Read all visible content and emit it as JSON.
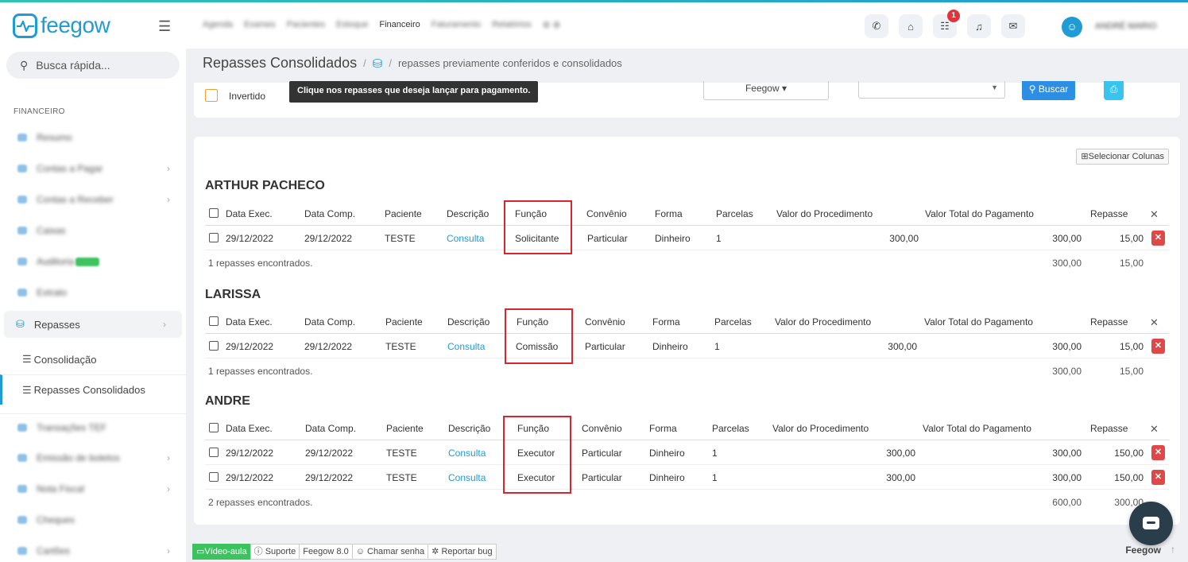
{
  "header": {
    "logo_text": "feegow",
    "nav_items": [
      "Agenda",
      "Exames",
      "Pacientes",
      "Estoque",
      "Financeiro",
      "Faturamento",
      "Relatórios"
    ],
    "active_nav": "Financeiro",
    "notification_count": "1",
    "username": "ANDRÉ MARIO"
  },
  "sidebar": {
    "search_placeholder": "Busca rápida...",
    "section_title": "FINANCEIRO",
    "items": [
      {
        "label": "Resumo"
      },
      {
        "label": "Contas a Pagar"
      },
      {
        "label": "Contas a Receber"
      },
      {
        "label": "Caixas"
      },
      {
        "label": "Auditoria"
      },
      {
        "label": "Extrato"
      },
      {
        "label": "Repasses"
      },
      {
        "label": "Consolidação"
      },
      {
        "label": "Repasses Consolidados"
      },
      {
        "label": "Transações TEF"
      },
      {
        "label": "Emissão de boletos"
      },
      {
        "label": "Nota Fiscal"
      },
      {
        "label": "Cheques"
      },
      {
        "label": "Cartões"
      }
    ]
  },
  "breadcrumb": {
    "title": "Repasses Consolidados",
    "subtitle": "repasses previamente conferidos e consolidados"
  },
  "filters": {
    "invertido_label": "Invertido",
    "tooltip": "Clique nos repasses que deseja lançar para pagamento.",
    "unit_select": "Feegow",
    "search_button": "Buscar"
  },
  "main": {
    "select_columns": "Selecionar Colunas",
    "columns": [
      "Data Exec.",
      "Data Comp.",
      "Paciente",
      "Descrição",
      "Função",
      "Convênio",
      "Forma",
      "Parcelas",
      "Valor do Procedimento",
      "Valor Total do Pagamento",
      "Repasse"
    ],
    "groups": [
      {
        "name": "ARTHUR PACHECO",
        "rows": [
          {
            "data_exec": "29/12/2022",
            "data_comp": "29/12/2022",
            "paciente": "TESTE",
            "descricao": "Consulta",
            "funcao": "Solicitante",
            "convenio": "Particular",
            "forma": "Dinheiro",
            "parcelas": "1",
            "valor_proc": "300,00",
            "valor_total": "300,00",
            "repasse": "15,00"
          }
        ],
        "summary": "1 repasses encontrados.",
        "total_pagamento": "300,00",
        "total_repasse": "15,00"
      },
      {
        "name": "LARISSA",
        "rows": [
          {
            "data_exec": "29/12/2022",
            "data_comp": "29/12/2022",
            "paciente": "TESTE",
            "descricao": "Consulta",
            "funcao": "Comissão",
            "convenio": "Particular",
            "forma": "Dinheiro",
            "parcelas": "1",
            "valor_proc": "300,00",
            "valor_total": "300,00",
            "repasse": "15,00"
          }
        ],
        "summary": "1 repasses encontrados.",
        "total_pagamento": "300,00",
        "total_repasse": "15,00"
      },
      {
        "name": "ANDRE",
        "rows": [
          {
            "data_exec": "29/12/2022",
            "data_comp": "29/12/2022",
            "paciente": "TESTE",
            "descricao": "Consulta",
            "funcao": "Executor",
            "convenio": "Particular",
            "forma": "Dinheiro",
            "parcelas": "1",
            "valor_proc": "300,00",
            "valor_total": "300,00",
            "repasse": "150,00"
          },
          {
            "data_exec": "29/12/2022",
            "data_comp": "29/12/2022",
            "paciente": "TESTE",
            "descricao": "Consulta",
            "funcao": "Executor",
            "convenio": "Particular",
            "forma": "Dinheiro",
            "parcelas": "1",
            "valor_proc": "300,00",
            "valor_total": "300,00",
            "repasse": "150,00"
          }
        ],
        "summary": "2 repasses encontrados.",
        "total_pagamento": "600,00",
        "total_repasse": "300,00"
      }
    ]
  },
  "footer": {
    "video": "Vídeo-aula",
    "suporte": "Suporte",
    "version": "Feegow 8.0",
    "chamar": "Chamar senha",
    "reportar": "Reportar bug",
    "brand": "Feegow"
  }
}
